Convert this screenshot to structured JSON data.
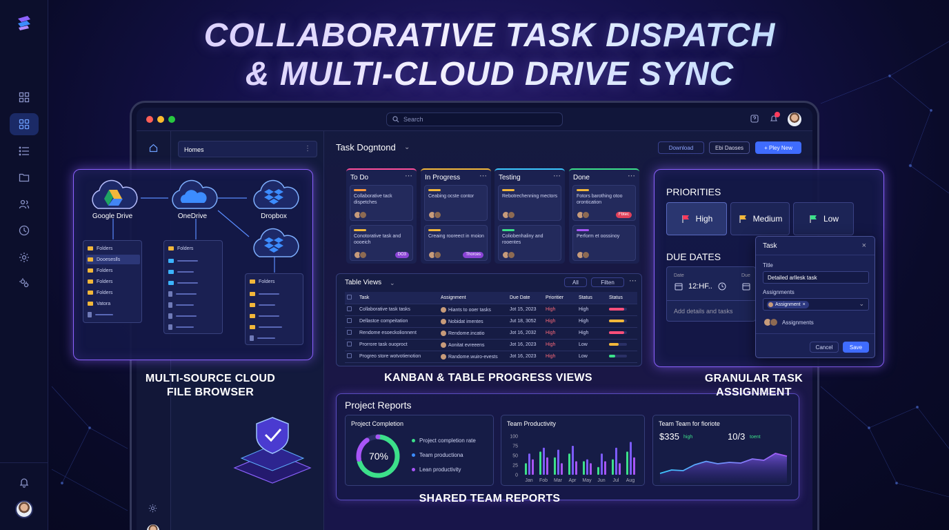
{
  "headline": {
    "line1": "COLLABORATIVE TASK DISPATCH",
    "line2": "& MULTI-CLOUD DRIVE SYNC"
  },
  "app": {
    "search_placeholder": "Search",
    "folder_pane_title": "Homes",
    "board_title": "Task Dogntond",
    "actions": {
      "download": "Download",
      "second": "Ebi Daoses",
      "new": "+ Pley New"
    }
  },
  "kanban": [
    {
      "title": "To Do",
      "accent": "#ff4f9a",
      "cards": [
        {
          "text": "Collaborative tack dispetches",
          "bar": "#ff9a3c",
          "tag": ""
        },
        {
          "text": "Conotorative task and oooeich",
          "bar": "#f2b73a",
          "tag": "DO3"
        }
      ]
    },
    {
      "title": "In Progress",
      "accent": "#f2b73a",
      "cards": [
        {
          "text": "Ceabing ocste contor",
          "bar": "#f2b73a",
          "tag": ""
        },
        {
          "text": "Creaing rooreect in rnoion",
          "bar": "#f2b73a",
          "tag": "Thorces"
        }
      ]
    },
    {
      "title": "Testing",
      "accent": "#3cc8ff",
      "cards": [
        {
          "text": "Rebotrechenning mectors",
          "bar": "#f2b73a",
          "tag": ""
        },
        {
          "text": "Coliobenhaliny and rooentes",
          "bar": "#3ce08a",
          "tag": ""
        }
      ]
    },
    {
      "title": "Done",
      "accent": "#3ce08a",
      "cards": [
        {
          "text": "Fotors barothing otoo orontication",
          "bar": "#f2b73a",
          "tag": "Fbtec"
        },
        {
          "text": "Perform et oossinoy",
          "bar": "#a855f7",
          "tag": ""
        }
      ]
    }
  ],
  "table": {
    "title": "Table Views",
    "buttons": {
      "all": "All",
      "filter": "Filten"
    },
    "headers": [
      "Task",
      "Assignment",
      "Due Date",
      "Prioritier",
      "Status",
      "Status"
    ],
    "rows": [
      {
        "task": "Collaborative task tasks",
        "assignee": "Hiants to ooer tasks",
        "due": "Jot 15, 2023",
        "priority": "High",
        "status": "High",
        "bar": 0.85,
        "barColor": "#ff4f7a"
      },
      {
        "task": "Dellastce compeitation",
        "assignee": "Nobidat imentes",
        "due": "Jut 18, 3052",
        "priority": "High",
        "status": "High",
        "bar": 0.85,
        "barColor": "#f2b73a"
      },
      {
        "task": "Rendome esoeckolionnent",
        "assignee": "Rendome.incatio",
        "due": "Jot 16, 2032",
        "priority": "High",
        "status": "High",
        "bar": 0.85,
        "barColor": "#ff4f7a"
      },
      {
        "task": "Prorrore task ouoproct",
        "assignee": "Aonitat evreeens",
        "due": "Jot 16, 2023",
        "priority": "High",
        "status": "Low",
        "bar": 0.55,
        "barColor": "#f2b73a"
      },
      {
        "task": "Progreo store wotvotienotion",
        "assignee": "Randome.wuiro-evests",
        "due": "Jot 16, 2023",
        "priority": "High",
        "status": "Low",
        "bar": 0.35,
        "barColor": "#3ce08a"
      }
    ]
  },
  "cloud": {
    "providers": [
      "Google Drive",
      "OneDrive",
      "Dropbox"
    ],
    "box1": {
      "title": "Folders",
      "rows": [
        "Dooeseslls",
        "Folders",
        "Folders",
        "Folders",
        "Vatora"
      ]
    },
    "box2": {
      "title": "Folders"
    },
    "box3": {
      "title": "Folders"
    },
    "caption": "MULTI-SOURCE CLOUD\nFILE BROWSER"
  },
  "kanban_caption": "KANBAN & TABLE PROGRESS VIEWS",
  "assign": {
    "priorities_title": "PRIORITIES",
    "priorities": [
      {
        "label": "High",
        "color": "#ff3b5c"
      },
      {
        "label": "Medium",
        "color": "#f2b73a"
      },
      {
        "label": "Low",
        "color": "#3ce08a"
      }
    ],
    "due_title": "DUE DATES",
    "date_label": "Date",
    "date_value": "12:HF..",
    "due_label": "Due",
    "add_details": "Add details and tasks",
    "dialog": {
      "title": "Task",
      "title_label": "Title",
      "title_value": "Detailed arllesk task",
      "assign_label": "Assignments",
      "chip": "Assignment",
      "assignees": "Assignments",
      "cancel": "Cancel",
      "save": "Save"
    },
    "caption": "GRANULAR TASK\nASSIGNMENT"
  },
  "reports": {
    "title": "Project Reports",
    "completion": {
      "title": "Project Completion",
      "value": "70%",
      "fraction": 0.7,
      "legend": [
        {
          "label": "Project completion rate",
          "color": "#3ce08a"
        },
        {
          "label": "Team productiona",
          "color": "#3c8cff"
        },
        {
          "label": "Lean productivity",
          "color": "#a855f7"
        }
      ]
    },
    "productivity": {
      "title": "Team Productivity"
    },
    "finance": {
      "title": "Team Team for fioriote",
      "amount": "$335",
      "amount_sub": "high",
      "ratio": "10/3",
      "ratio_sub": "toent"
    },
    "caption": "SHARED TEAM REPORTS"
  },
  "chart_data": [
    {
      "type": "bar",
      "title": "Team Productivity",
      "categories": [
        "Jan",
        "Fob",
        "Mar",
        "Apr",
        "May",
        "Jun",
        "Jul",
        "Aug"
      ],
      "y_ticks": [
        "100",
        "75",
        "50",
        "25",
        "0"
      ],
      "ylim": [
        0,
        100
      ],
      "series": [
        {
          "values": [
            30,
            60,
            45,
            55,
            35,
            20,
            40,
            60
          ],
          "color": "#3ce08a"
        },
        {
          "values": [
            55,
            70,
            65,
            75,
            40,
            55,
            70,
            85
          ],
          "color": "#7c5cff"
        },
        {
          "values": [
            40,
            45,
            30,
            35,
            30,
            35,
            30,
            45
          ],
          "color": "#a855f7"
        }
      ]
    },
    {
      "type": "area",
      "title": "Team Team for fioriote",
      "x": [
        1,
        2,
        3,
        4,
        5,
        6,
        7,
        8,
        9,
        10,
        11,
        12
      ],
      "values": [
        20,
        30,
        28,
        45,
        55,
        48,
        52,
        50,
        62,
        58,
        78,
        70
      ],
      "ylim": [
        0,
        100
      ]
    }
  ],
  "colors": {
    "accent": "#8d62ff",
    "primary_button": "#3f6cff"
  }
}
